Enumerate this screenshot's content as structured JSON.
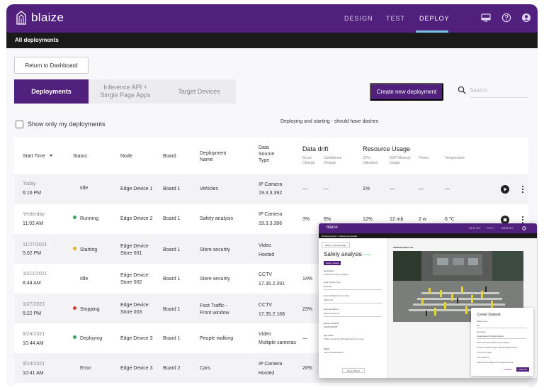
{
  "app": {
    "logo_text": "blaize",
    "nav": [
      "DESIGN",
      "TEST",
      "DEPLOY"
    ],
    "active_nav": "DEPLOY",
    "icons": [
      "monitor-icon",
      "help-icon",
      "account-icon"
    ]
  },
  "subbar": {
    "title": "All deployments"
  },
  "toolbar": {
    "return_label": "Return to Dashboard",
    "tabs": [
      "Deployments",
      "Inference API + Single Page Apps",
      "Target Devices"
    ],
    "create_label": "Create new deployment",
    "search_placeholder": "Search"
  },
  "filters": {
    "show_mine_label": "Show only my deployments",
    "note": "Deploying and starting - should have dashes"
  },
  "table": {
    "headers": {
      "start_time": "Start Time",
      "status": "Status",
      "node": "Node",
      "board": "Board",
      "deployment_name": "Deployment Name",
      "data_source_type": "Data Source Type",
      "data_drift": "Data drift",
      "score_change": "Score Change",
      "confidence_change": "Confidence Change",
      "resource_usage": "Resource Usage",
      "cpu": "CPU Utilization",
      "gsp": "GSP Memory Usage",
      "power": "Power",
      "temperature": "Temperature"
    },
    "rows": [
      {
        "date": "Today",
        "time": "6:16 PM",
        "status": "Idle",
        "status_color": "",
        "node": "Edge Device 1",
        "board": "Board 1",
        "name": "Vehicles",
        "source": "IP Camera",
        "source2": "19.3.3.392",
        "score": "—",
        "conf": "—",
        "cpu": "1%",
        "gsp": "—",
        "power": "—",
        "temp": "—",
        "action": "play"
      },
      {
        "date": "Yesterday",
        "time": "11:02 AM",
        "status": "Running",
        "status_color": "#3aa55b",
        "node": "Edge Device 2",
        "board": "Board 1",
        "name": "Safety analysis",
        "source": "IP Camera",
        "source2": "19.3.3.386",
        "score": "3%",
        "conf": "6%",
        "cpu": "12%",
        "gsp": "12 mb",
        "power": "2 w",
        "temp": "6 ℃",
        "action": "stop"
      },
      {
        "date": "11/27/2021",
        "time": "5:02 PM",
        "status": "Starting",
        "status_color": "#e5b02c",
        "node": "Edge Device Store 001",
        "board": "Board 1",
        "name": "Store security",
        "source": "Video",
        "source2": "Hosted",
        "score": "",
        "conf": "",
        "cpu": "",
        "gsp": "",
        "power": "",
        "temp": "",
        "action": ""
      },
      {
        "date": "10/11/2021",
        "time": "8:44 AM",
        "status": "Idle",
        "status_color": "",
        "node": "Edge Device Store 002",
        "board": "Board 1",
        "name": "Store security",
        "source": "CCTV",
        "source2": "17.35.2.391",
        "score": "14%",
        "conf": "",
        "cpu": "",
        "gsp": "",
        "power": "",
        "temp": "",
        "action": ""
      },
      {
        "date": "10/7/2021",
        "time": "5:22 PM",
        "status": "Stopping",
        "status_color": "#d23b3b",
        "node": "Edge Device Store 003",
        "board": "Board 1",
        "name": "Foot Traffic - Front window",
        "source": "CCTV",
        "source2": "17.35.2.168",
        "score": "23%",
        "conf": "",
        "cpu": "",
        "gsp": "",
        "power": "",
        "temp": "",
        "action": ""
      },
      {
        "date": "9/24/2021",
        "time": "10:44 AM",
        "status": "Deploying",
        "status_color": "#3aa55b",
        "node": "Edge Device 3",
        "board": "Board 1",
        "name": "People walking",
        "source": "Video",
        "source2": "Multiple cameras",
        "score": "—",
        "conf": "",
        "cpu": "",
        "gsp": "",
        "power": "",
        "temp": "",
        "action": ""
      },
      {
        "date": "9/24/2021",
        "time": "10:41 AM",
        "status": "Error",
        "status_color": "",
        "node": "Edge Device 3",
        "board": "Board 2",
        "name": "Cars",
        "source": "IP Camera",
        "source2": "Hosted",
        "score": "26%",
        "conf": "",
        "cpu": "",
        "gsp": "",
        "power": "",
        "temp": "",
        "action": ""
      }
    ]
  },
  "overlay": {
    "logo_text": "blaize",
    "nav": [
      "DESIGN",
      "TEST",
      "DEPLOY"
    ],
    "crumb": "All deployments  >  Deployment details",
    "back_label": "Back to previous page",
    "title": "Safety analysis",
    "status": "• Running",
    "button_label": "Deploy Model",
    "description_label": "Description",
    "description": "Production safety analysis",
    "field1_label": "Data Source Type",
    "field1_value": "External",
    "field2_label": "External Data Source Type",
    "field2_value": "Video link",
    "field3_label": "External Source",
    "field3_value": "Select stream id",
    "device_label": "Device serial ID",
    "device_value": "ISN29ND3978",
    "app_label": "App name",
    "app_value": "Traffic monitoring (ID) Deployed 4 min ago",
    "model_label": "Model",
    "model_value": "Vest V4 Workstations",
    "bottom_btn": "Return Model",
    "right_label": "WORKER RESULTS",
    "dialog": {
      "title": "Create Dataset",
      "lines": [
        "Dataset name",
        "test",
        "Description",
        "Create dataset for Safety Analysis",
        "Select what type of data to add to dataset",
        "Fixed the confident images with the assigned labels",
        "Unfixed the images",
        "Low confidence",
        "Select without changes to the assigned classes"
      ],
      "cancel": "CANCEL",
      "save": "CREATE"
    }
  }
}
